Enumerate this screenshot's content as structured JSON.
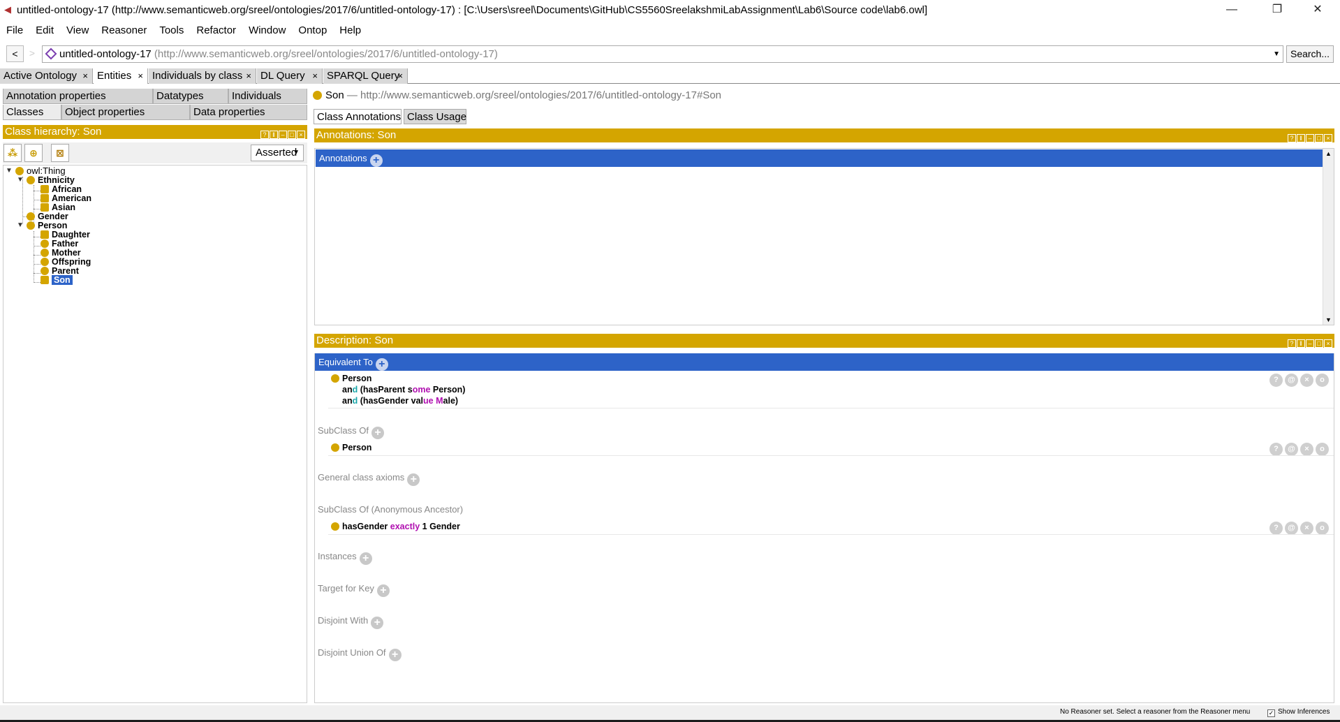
{
  "window": {
    "title": "untitled-ontology-17 (http://www.semanticweb.org/sreel/ontologies/2017/6/untitled-ontology-17)  : [C:\\Users\\sreel\\Documents\\GitHub\\CS5560SreelakshmiLabAssignment\\Lab6\\Source code\\lab6.owl]",
    "minimize": "—",
    "restore": "❐",
    "close": "✕"
  },
  "menu": [
    "File",
    "Edit",
    "View",
    "Reasoner",
    "Tools",
    "Refactor",
    "Window",
    "Ontop",
    "Help"
  ],
  "nav": {
    "back": "<",
    "forward": ">",
    "ontology_name": "untitled-ontology-17",
    "ontology_iri": " (http://www.semanticweb.org/sreel/ontologies/2017/6/untitled-ontology-17)",
    "search_label": "Search..."
  },
  "tabs": [
    {
      "label": "Active Ontology",
      "close": "×"
    },
    {
      "label": "Entities",
      "close": "×"
    },
    {
      "label": "Individuals by class",
      "close": "×"
    },
    {
      "label": "DL Query",
      "close": "×"
    },
    {
      "label": "SPARQL Query",
      "close": "×"
    }
  ],
  "entity_subtabs": {
    "row1": [
      "Annotation properties",
      "Datatypes",
      "Individuals"
    ],
    "row2": [
      "Classes",
      "Object properties",
      "Data properties"
    ]
  },
  "class_hierarchy": {
    "header": "Class hierarchy: Son",
    "mode": "Asserted",
    "tree": [
      {
        "label": "owl:Thing"
      },
      {
        "label": "Ethnicity"
      },
      {
        "label": "African"
      },
      {
        "label": "American"
      },
      {
        "label": "Asian"
      },
      {
        "label": "Gender"
      },
      {
        "label": "Person"
      },
      {
        "label": "Daughter"
      },
      {
        "label": "Father"
      },
      {
        "label": "Mother"
      },
      {
        "label": "Offspring"
      },
      {
        "label": "Parent"
      },
      {
        "label": "Son"
      }
    ],
    "selected": "Son"
  },
  "entity": {
    "name": "Son",
    "iri": " — http://www.semanticweb.org/sreel/ontologies/2017/6/untitled-ontology-17#Son"
  },
  "right_tabs": [
    "Class Annotations",
    "Class Usage"
  ],
  "annotations": {
    "header": "Annotations: Son",
    "bar_label": "Annotations"
  },
  "description": {
    "header": "Description: Son",
    "equivalent_to": {
      "label": "Equivalent To",
      "lines": [
        {
          "cls": "Person"
        },
        {
          "kw1": "an",
          "kw1b": "d",
          "rest1": " (hasParent ",
          "kw2": "s",
          "kw2b": "ome",
          "rest2": " Person)"
        },
        {
          "kw1": "an",
          "kw1b": "d",
          "rest1": " (hasGender val",
          "kw2": "ue",
          "rest2": " ",
          "kw3": "M",
          "rest3": "ale)"
        }
      ]
    },
    "subclass_of": {
      "label": "SubClass Of",
      "value": "Person"
    },
    "general_axioms": {
      "label": "General class axioms"
    },
    "anon_ancestor": {
      "label": "SubClass Of (Anonymous Ancestor)",
      "prop": "hasGender ",
      "kw": "exactly",
      "rest": " 1 Gender"
    },
    "instances": {
      "label": "Instances"
    },
    "target_for_key": {
      "label": "Target for Key"
    },
    "disjoint_with": {
      "label": "Disjoint With"
    },
    "disjoint_union": {
      "label": "Disjoint Union Of"
    }
  },
  "status": {
    "message": "No Reasoner set. Select a reasoner from the Reasoner menu",
    "show_inferences": "Show Inferences",
    "show_inferences_checked": true
  },
  "colors": {
    "header_gold": "#d4a500",
    "selection_blue": "#2d63c8",
    "keyword_teal": "#17a5a8",
    "keyword_magenta": "#b00fb0"
  }
}
